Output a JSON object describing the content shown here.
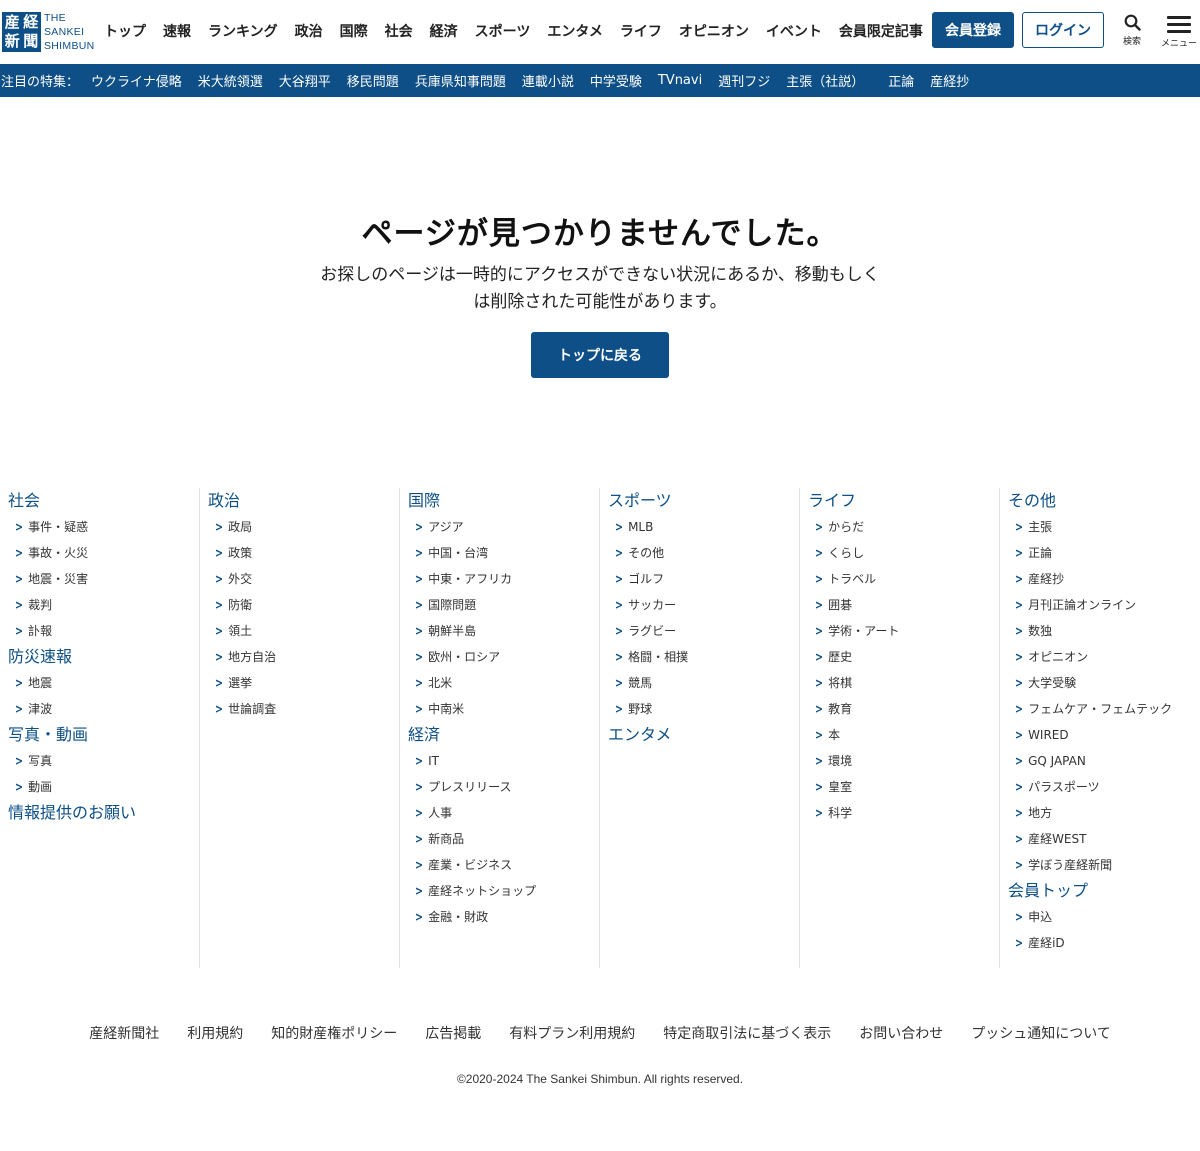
{
  "logo": {
    "kanji": [
      "産",
      "経",
      "新",
      "聞"
    ],
    "line1": "THE",
    "line2": "SANKEI",
    "line3": "SHIMBUN"
  },
  "nav": [
    "トップ",
    "速報",
    "ランキング",
    "政治",
    "国際",
    "社会",
    "経済",
    "スポーツ",
    "エンタメ",
    "ライフ",
    "オピニオン",
    "イベント",
    "会員限定記事"
  ],
  "header": {
    "register_label": "会員登録",
    "login_label": "ログイン",
    "search_label": "検索",
    "menu_label": "メニュー",
    "search_icon": "search-icon",
    "menu_icon": "hamburger-icon"
  },
  "featurebar": {
    "label": "注目の特集：",
    "items": [
      "ウクライナ侵略",
      "米大統領選",
      "大谷翔平",
      "移民問題",
      "兵庫県知事問題",
      "連載小説",
      "中学受験",
      "TVnavi",
      "週刊フジ",
      "主張（社説）",
      "正論",
      "産経抄"
    ]
  },
  "notfound": {
    "title": "ページが見つかりませんでした。",
    "message_line1": "お探しのページは一時的にアクセスができない状況にあるか、移動もしく",
    "message_line2": "は削除された可能性があります。",
    "button_label": "トップに戻る"
  },
  "sitemap": [
    {
      "groups": [
        {
          "title": "社会",
          "items": [
            "事件・疑惑",
            "事故・火災",
            "地震・災害",
            "裁判",
            "訃報"
          ]
        },
        {
          "title": "防災速報",
          "items": [
            "地震",
            "津波"
          ]
        },
        {
          "title": "写真・動画",
          "items": [
            "写真",
            "動画"
          ]
        },
        {
          "title": "情報提供のお願い",
          "items": []
        }
      ]
    },
    {
      "groups": [
        {
          "title": "政治",
          "items": [
            "政局",
            "政策",
            "外交",
            "防衛",
            "領土",
            "地方自治",
            "選挙",
            "世論調査"
          ]
        }
      ]
    },
    {
      "groups": [
        {
          "title": "国際",
          "items": [
            "アジア",
            "中国・台湾",
            "中東・アフリカ",
            "国際問題",
            "朝鮮半島",
            "欧州・ロシア",
            "北米",
            "中南米"
          ]
        },
        {
          "title": "経済",
          "items": [
            "IT",
            "プレスリリース",
            "人事",
            "新商品",
            "産業・ビジネス",
            "産経ネットショップ",
            "金融・財政"
          ]
        }
      ]
    },
    {
      "groups": [
        {
          "title": "スポーツ",
          "items": [
            "MLB",
            "その他",
            "ゴルフ",
            "サッカー",
            "ラグビー",
            "格闘・相撲",
            "競馬",
            "野球"
          ]
        },
        {
          "title": "エンタメ",
          "items": []
        }
      ]
    },
    {
      "groups": [
        {
          "title": "ライフ",
          "items": [
            "からだ",
            "くらし",
            "トラベル",
            "囲碁",
            "学術・アート",
            "歴史",
            "将棋",
            "教育",
            "本",
            "環境",
            "皇室",
            "科学"
          ]
        }
      ]
    },
    {
      "groups": [
        {
          "title": "その他",
          "items": [
            "主張",
            "正論",
            "産経抄",
            "月刊正論オンライン",
            "数独",
            "オピニオン",
            "大学受験",
            "フェムケア・フェムテック",
            "WIRED",
            "GQ JAPAN",
            "パラスポーツ",
            "地方",
            "産経WEST",
            "学ぼう産経新聞"
          ]
        },
        {
          "title": "会員トップ",
          "items": [
            "申込",
            "産経iD"
          ]
        }
      ]
    }
  ],
  "footer": {
    "links": [
      "産経新聞社",
      "利用規約",
      "知的財産権ポリシー",
      "広告掲載",
      "有料プラン利用規約",
      "特定商取引法に基づく表示",
      "お問い合わせ",
      "プッシュ通知について"
    ],
    "copyright": "©2020-2024 The Sankei Shimbun. All rights reserved."
  },
  "colors": {
    "brand": "#0d4f86",
    "text": "#222222"
  }
}
